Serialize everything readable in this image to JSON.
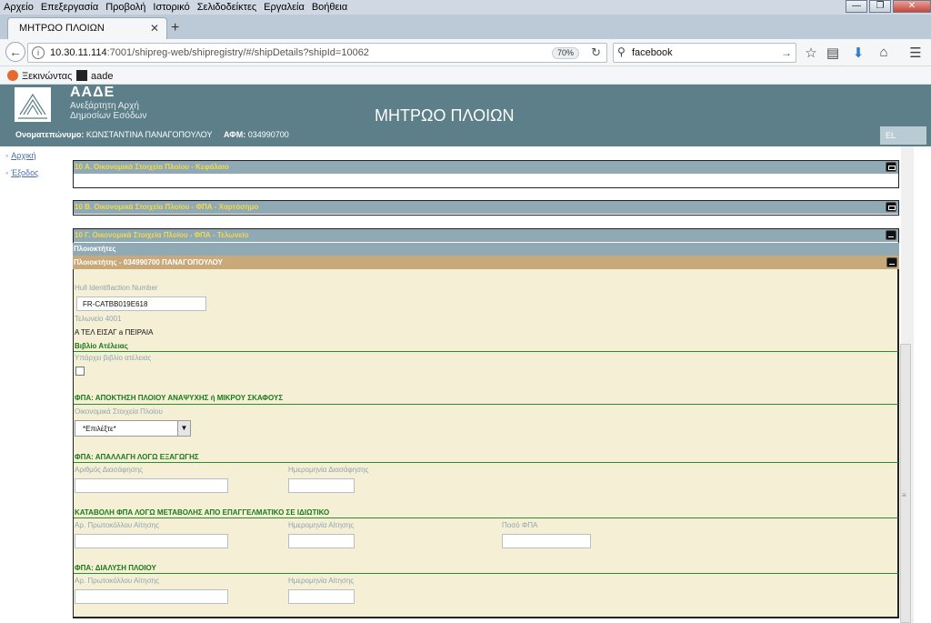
{
  "browser": {
    "menu": [
      "Αρχείο",
      "Επεξεργασία",
      "Προβολή",
      "Ιστορικό",
      "Σελιδοδείκτες",
      "Εργαλεία",
      "Βοήθεια"
    ],
    "tab_title": "ΜΗΤΡΩΟ ΠΛΟΙΩΝ",
    "url_host": "10.30.11.114",
    "url_rest": ":7001/shipreg-web/shipregistry/#/shipDetails?shipId=10062",
    "zoom": "70%",
    "search_value": "facebook",
    "bookmarks": [
      {
        "label": "Ξεκινώντας"
      },
      {
        "label": "aade"
      }
    ]
  },
  "header": {
    "logo_title": "ΑΑΔΕ",
    "logo_sub_1": "Ανεξάρτητη Αρχή",
    "logo_sub_2": "Δημοσίων Εσόδων",
    "page_title": "ΜΗΤΡΩΟ ΠΛΟΙΩΝ",
    "user_label": "Ονοματεπώνυμο:",
    "user_name": "ΚΩΝΣΤΑΝΤΙΝΑ ΠΑΝΑΓΟΠΟΥΛΟΥ",
    "afm_label": "ΑΦΜ:",
    "afm_value": "034990700",
    "lang": "EL"
  },
  "sidebar": {
    "items": [
      {
        "label": "Αρχική"
      },
      {
        "label": "Έξοδος"
      }
    ]
  },
  "panels": {
    "p10a": "10 Α. Οικονομικά Στοιχεία Πλοίου - Κεφάλαιο",
    "p10b": "10 Β. Οικονομικά Στοιχεία Πλοίου - ΦΠΑ - Χαρτόσημο",
    "p10c": "10 Γ. Οικονομικά Στοιχεία Πλοίου - ΦΠΑ - Τελωνείο",
    "owners": "Πλοιοκτήτες",
    "owner": "Πλοιοκτήτης - 034990700 ΠΑΝΑΓΟΠΟΥΛΟΥ"
  },
  "form": {
    "hin_label": "Hull Identifiaction Number",
    "hin_value": "FR-CATBB019E618",
    "customs_label": "Τελωνείο 4001",
    "customs_value": "Α ΤΕΛ ΕΙΣΑΓ a ΠΕΙΡΑΙΑ",
    "section_book": "Βιβλίο Ατέλειας",
    "book_exists_label": "Υπάρχει βιβλίο ατέλειας",
    "book_exists_checked": false,
    "section_acq": "ΦΠΑ: ΑΠΟΚΤΗΣΗ ΠΛΟΙΟΥ ΑΝΑΨΥΧΗΣ ή ΜΙΚΡΟΥ ΣΚΑΦΟΥΣ",
    "fin_label": "Οικονομικά Στοιχεία Πλοίου",
    "fin_selected": "*Επιλέξτε*",
    "section_export": "ΦΠΑ: ΑΠΑΛΛΑΓΗ ΛΟΓΩ ΕΞΑΓΩΓΗΣ",
    "clearance_no_label": "Αριθμός Διασάφησης",
    "clearance_no_value": "",
    "clearance_date_label": "Ημερομηνία Διασάφησης",
    "clearance_date_value": "",
    "section_change": "ΚΑΤΑΒΟΛΗ ΦΠΑ ΛΟΓΩ ΜΕΤΑΒΟΛΗΣ ΑΠΟ ΕΠΑΓΓΕΛΜΑΤΙΚΟ ΣΕ ΙΔΙΩΤΙΚΟ",
    "protocol_label": "Αρ. Πρωτοκόλλου Αίτησης",
    "protocol_value": "",
    "app_date_label": "Ημερομηνία Αίτησης",
    "app_date_value": "",
    "vat_amount_label": "Ποσό ΦΠΑ",
    "vat_amount_value": "",
    "section_dissolve": "ΦΠΑ: ΔΙΑΛΥΣΗ ΠΛΟΙΟΥ",
    "protocol2_label": "Αρ. Πρωτοκόλλου Αίτησης",
    "protocol2_value": "",
    "app_date2_label": "Ημερομηνία Αίτησης",
    "app_date2_value": ""
  },
  "colors": {
    "header_bg": "#5c7f8a",
    "panel_header": "#8faab5",
    "panel_title": "#f3d84a",
    "owner_bar": "#c9a97a",
    "form_bg": "#f5efd5",
    "section_green": "#1a7a1a"
  }
}
